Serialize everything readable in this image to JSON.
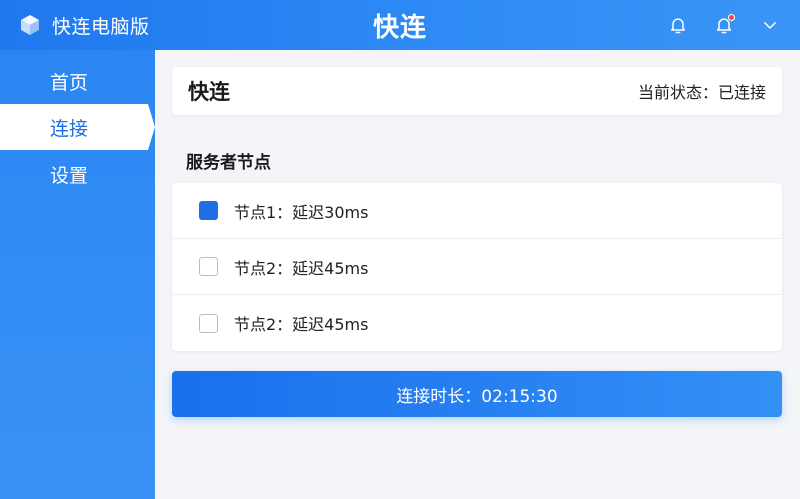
{
  "app": {
    "brand_name": "快连电脑版",
    "window_title": "快连"
  },
  "topbar": {
    "icons": [
      "cube-logo-icon",
      "bell-icon",
      "notification-bell-icon",
      "chevron-down-icon"
    ],
    "notification_dot_color": "#ff4040"
  },
  "sidebar": {
    "items": [
      {
        "label": "首页",
        "active": false
      },
      {
        "label": "连接",
        "active": true
      },
      {
        "label": "设置",
        "active": false
      }
    ]
  },
  "header": {
    "title": "快连",
    "status": "当前状态：已连接"
  },
  "nodes": {
    "section_title": "服务者节点",
    "items": [
      {
        "label": "节点1：延迟30ms",
        "checked": true
      },
      {
        "label": "节点2：延迟45ms",
        "checked": false
      },
      {
        "label": "节点2：延迟45ms",
        "checked": false
      }
    ]
  },
  "footer": {
    "duration_label": "连接时长：02:15:30"
  },
  "colors": {
    "accent": "#1e6fe6",
    "sidebar": "#2a86f3",
    "background": "#f3f5f9"
  }
}
